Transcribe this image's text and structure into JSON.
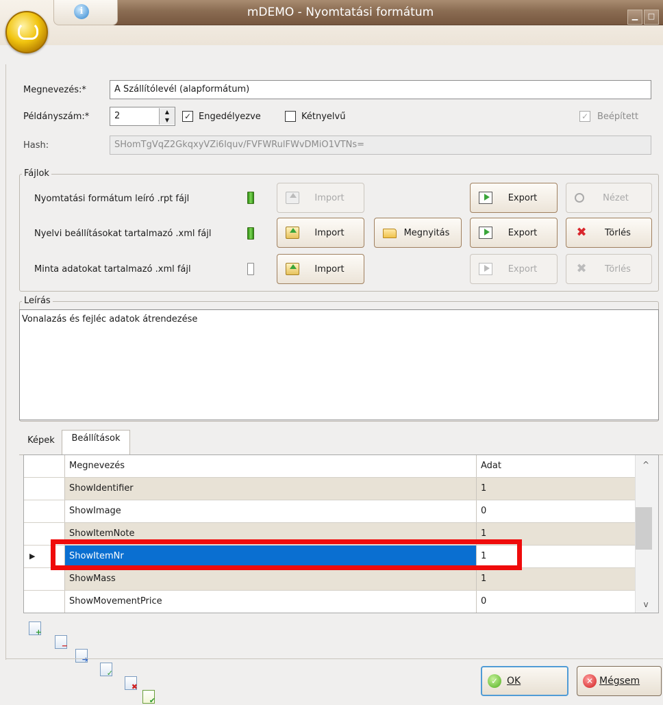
{
  "window": {
    "title": "mDEMO - Nyomtatási formátum",
    "info_icon_label": "i",
    "minimize_glyph": "▁",
    "maximize_glyph": "□"
  },
  "form": {
    "name_label": "Megnevezés:*",
    "name_value": "A Szállítólevél (alapformátum)",
    "copies_label": "Példányszám:*",
    "copies_value": "2",
    "enabled_label": "Engedélyezve",
    "enabled_checked": true,
    "bilingual_label": "Kétnyelvű",
    "bilingual_checked": false,
    "builtin_label": "Beépített",
    "builtin_checked": true,
    "hash_label": "Hash:",
    "hash_value": "SHomTgVqZ2GkqxyVZi6Iquv/FVFWRulFWvDMiO1VTNs="
  },
  "files": {
    "group_title": "Fájlok",
    "rows": [
      {
        "label": "Nyomtatási formátum leíró .rpt fájl",
        "status": "full",
        "import": "Import",
        "export": "Export",
        "extra": "Nézet"
      },
      {
        "label": "Nyelvi beállításokat tartalmazó .xml fájl",
        "status": "full",
        "import": "Import",
        "open": "Megnyitás",
        "export": "Export",
        "extra": "Törlés"
      },
      {
        "label": "Minta adatokat tartalmazó .xml fájl",
        "status": "empty",
        "import": "Import",
        "export": "Export",
        "extra": "Törlés"
      }
    ]
  },
  "description": {
    "group_title": "Leírás",
    "text": "Vonalazás és fejléc adatok átrendezése"
  },
  "tabs": [
    {
      "label": "Képek",
      "active": false
    },
    {
      "label": "Beállítások",
      "active": true
    }
  ],
  "grid": {
    "headers": [
      "Megnevezés",
      "Adat"
    ],
    "rows": [
      {
        "name": "ShowIdentifier",
        "value": "1"
      },
      {
        "name": "ShowImage",
        "value": "0"
      },
      {
        "name": "ShowItemNote",
        "value": "1"
      },
      {
        "name": "ShowItemNr",
        "value": "1",
        "selected": true
      },
      {
        "name": "ShowMass",
        "value": "1"
      },
      {
        "name": "ShowMovementPrice",
        "value": "0"
      }
    ],
    "row_indicator": "▶",
    "scroll_up": "^",
    "scroll_down": "v"
  },
  "toolbar": {
    "icons": [
      "add-row-icon",
      "delete-row-icon",
      "move-row-icon",
      "edit-row-icon",
      "delete-all-icon",
      "check-all-icon"
    ]
  },
  "buttons": {
    "ok": "OK",
    "cancel": "Mégsem"
  },
  "colors": {
    "title_bar": "#8a6c52",
    "selection": "#0a6fd1",
    "highlight": "#ef0b0b",
    "row_alt": "#e8e2d6"
  }
}
